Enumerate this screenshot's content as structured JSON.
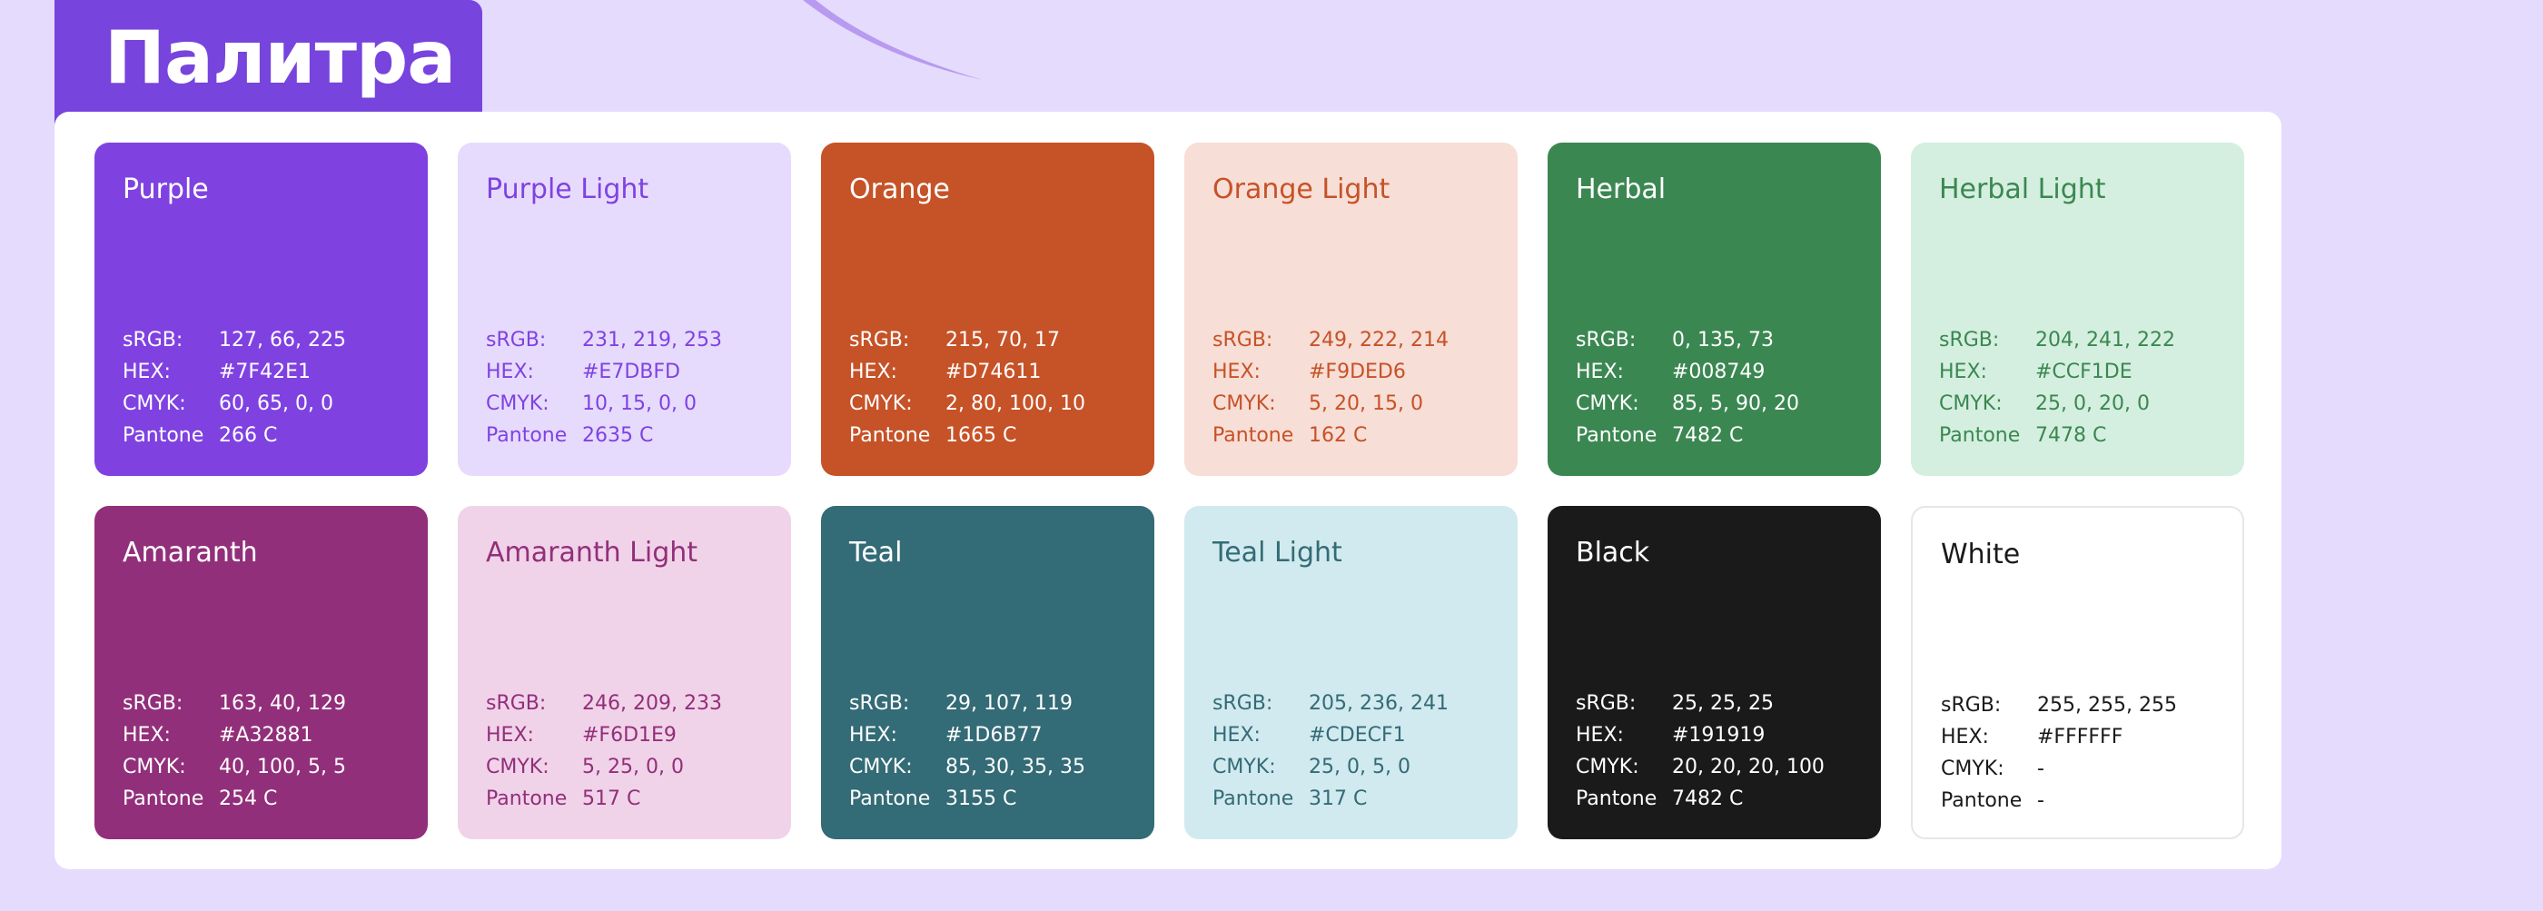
{
  "title": "Палитра",
  "colors": {
    "background": "#E5DBFD",
    "title_tab": "#7744DD",
    "panel": "#FFFFFF",
    "swoosh": "#B89AF0"
  },
  "cards": [
    {
      "name": "Purple",
      "bg": "#7F42E1",
      "fg": "#FFFFFF",
      "specs": [
        {
          "label": "sRGB:",
          "value": "127, 66, 225"
        },
        {
          "label": "HEX:",
          "value": "#7F42E1"
        },
        {
          "label": "CMYK:",
          "value": "60, 65, 0, 0"
        },
        {
          "label": "Pantone",
          "value": "266 C"
        }
      ]
    },
    {
      "name": "Purple Light",
      "bg": "#E7DBFD",
      "fg": "#7F42E1",
      "specs": [
        {
          "label": "sRGB:",
          "value": "231, 219, 253"
        },
        {
          "label": "HEX:",
          "value": "#E7DBFD"
        },
        {
          "label": "CMYK:",
          "value": "10, 15, 0, 0"
        },
        {
          "label": "Pantone",
          "value": "2635 C"
        }
      ]
    },
    {
      "name": "Orange",
      "bg": "#C65227",
      "fg": "#FFFFFF",
      "specs": [
        {
          "label": "sRGB:",
          "value": "215, 70, 17"
        },
        {
          "label": "HEX:",
          "value": "#D74611"
        },
        {
          "label": "CMYK:",
          "value": "2, 80, 100, 10"
        },
        {
          "label": "Pantone",
          "value": "1665 C"
        }
      ]
    },
    {
      "name": "Orange Light",
      "bg": "#F7DED6",
      "fg": "#C65227",
      "specs": [
        {
          "label": "sRGB:",
          "value": "249, 222, 214"
        },
        {
          "label": "HEX:",
          "value": "#F9DED6"
        },
        {
          "label": "CMYK:",
          "value": "5, 20, 15, 0"
        },
        {
          "label": "Pantone",
          "value": "162 C"
        }
      ]
    },
    {
      "name": "Herbal",
      "bg": "#3B8751",
      "fg": "#FFFFFF",
      "specs": [
        {
          "label": "sRGB:",
          "value": "0, 135, 73"
        },
        {
          "label": "HEX:",
          "value": "#008749"
        },
        {
          "label": "CMYK:",
          "value": "85, 5, 90, 20"
        },
        {
          "label": "Pantone",
          "value": "7482 C"
        }
      ]
    },
    {
      "name": "Herbal Light",
      "bg": "#D4EFDF",
      "fg": "#3B8751",
      "specs": [
        {
          "label": "sRGB:",
          "value": "204, 241, 222"
        },
        {
          "label": "HEX:",
          "value": "#CCF1DE"
        },
        {
          "label": "CMYK:",
          "value": "25, 0, 20, 0"
        },
        {
          "label": "Pantone",
          "value": "7478 C"
        }
      ]
    },
    {
      "name": "Amaranth",
      "bg": "#922F7A",
      "fg": "#FFFFFF",
      "specs": [
        {
          "label": "sRGB:",
          "value": "163, 40, 129"
        },
        {
          "label": "HEX:",
          "value": "#A32881"
        },
        {
          "label": "CMYK:",
          "value": "40, 100, 5, 5"
        },
        {
          "label": "Pantone",
          "value": "254 C"
        }
      ]
    },
    {
      "name": "Amaranth Light",
      "bg": "#F1D3E9",
      "fg": "#922F7A",
      "specs": [
        {
          "label": "sRGB:",
          "value": "246, 209, 233"
        },
        {
          "label": "HEX:",
          "value": "#F6D1E9"
        },
        {
          "label": "CMYK:",
          "value": "5, 25, 0, 0"
        },
        {
          "label": "Pantone",
          "value": "517 C"
        }
      ]
    },
    {
      "name": "Teal",
      "bg": "#336B76",
      "fg": "#FFFFFF",
      "specs": [
        {
          "label": "sRGB:",
          "value": "29, 107, 119"
        },
        {
          "label": "HEX:",
          "value": "#1D6B77"
        },
        {
          "label": "CMYK:",
          "value": "85, 30, 35, 35"
        },
        {
          "label": "Pantone",
          "value": "3155 C"
        }
      ]
    },
    {
      "name": "Teal Light",
      "bg": "#D1EAEF",
      "fg": "#336B76",
      "specs": [
        {
          "label": "sRGB:",
          "value": "205, 236, 241"
        },
        {
          "label": "HEX:",
          "value": "#CDECF1"
        },
        {
          "label": "CMYK:",
          "value": "25, 0, 5, 0"
        },
        {
          "label": "Pantone",
          "value": "317 C"
        }
      ]
    },
    {
      "name": "Black",
      "bg": "#1A1A1A",
      "fg": "#FFFFFF",
      "specs": [
        {
          "label": "sRGB:",
          "value": "25, 25, 25"
        },
        {
          "label": "HEX:",
          "value": "#191919"
        },
        {
          "label": "CMYK:",
          "value": "20, 20, 20, 100"
        },
        {
          "label": "Pantone",
          "value": "7482 C"
        }
      ]
    },
    {
      "name": "White",
      "bg": "#FFFFFF",
      "fg": "#1A1A1A",
      "bordered": true,
      "specs": [
        {
          "label": "sRGB:",
          "value": "255, 255, 255"
        },
        {
          "label": "HEX:",
          "value": "#FFFFFF"
        },
        {
          "label": "CMYK:",
          "value": "-"
        },
        {
          "label": "Pantone",
          "value": "-"
        }
      ]
    }
  ]
}
